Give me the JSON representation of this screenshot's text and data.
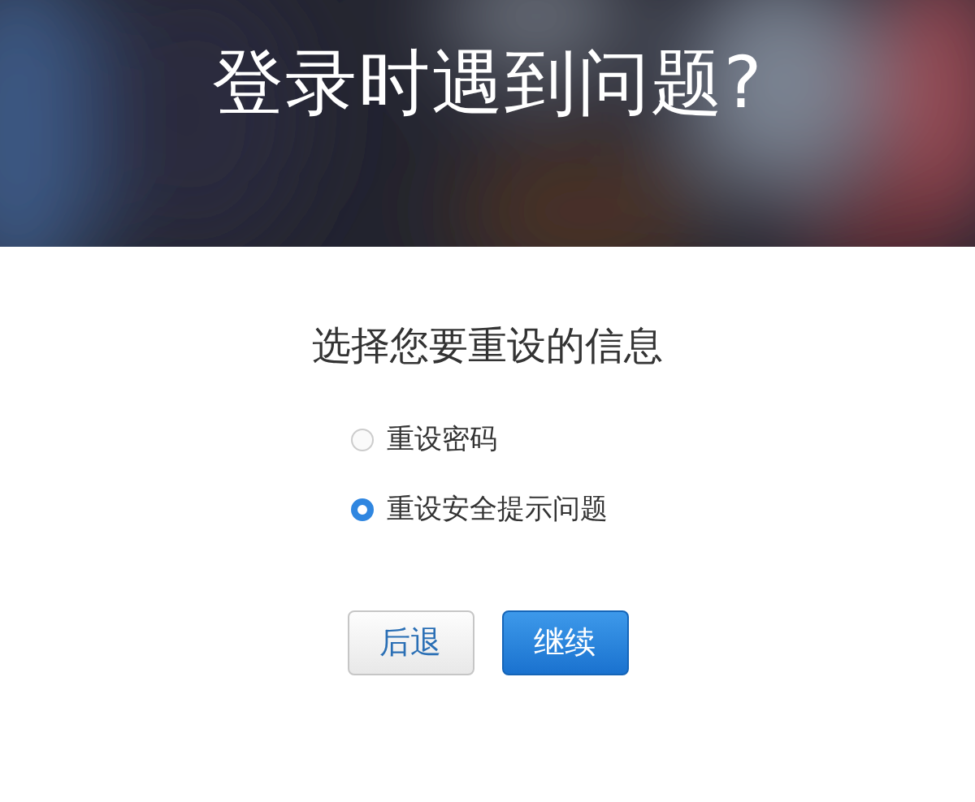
{
  "header": {
    "kind": "picture",
    "title": "登录时遇到问题?"
  },
  "heading": "选择您要重设的信息",
  "options": [
    {
      "label": "重设密码",
      "selected": false
    },
    {
      "label": "重设安全提示问题",
      "selected": true
    }
  ],
  "buttons": [
    {
      "label": "后退",
      "kind": "secondary"
    },
    {
      "label": "继续",
      "kind": "primary"
    }
  ]
}
